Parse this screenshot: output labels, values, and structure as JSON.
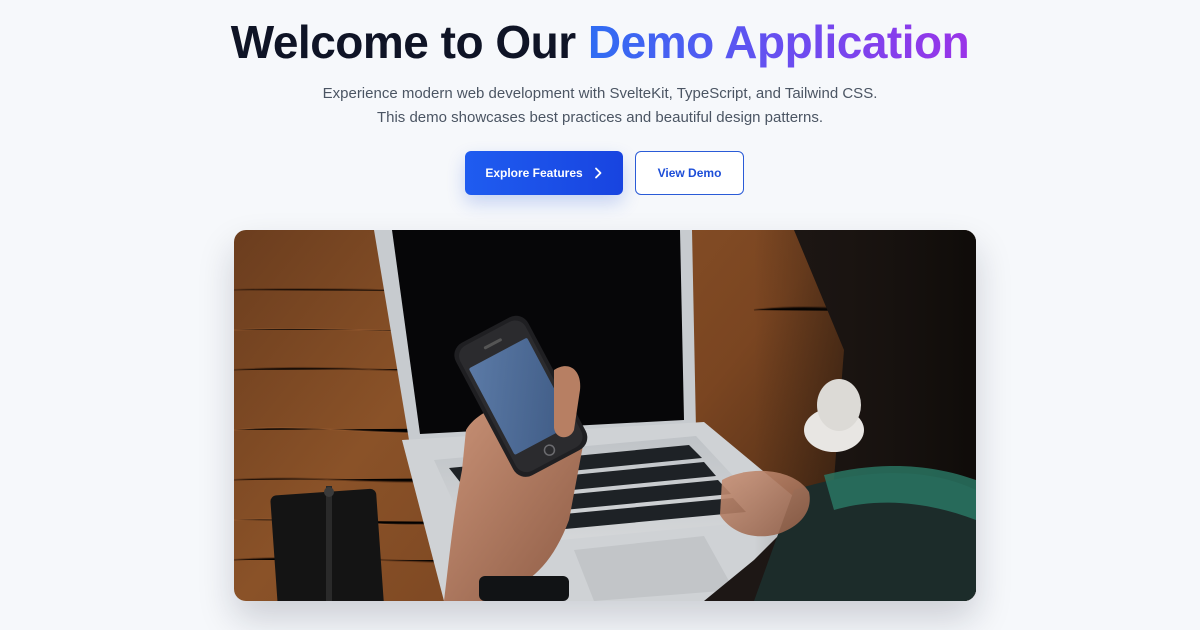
{
  "hero": {
    "title_prefix": "Welcome to Our",
    "title_accent": "Demo Application",
    "subtitle_line1": "Experience modern web development with SvelteKit, TypeScript, and Tailwind CSS.",
    "subtitle_line2": "This demo showcases best practices and beautiful design patterns.",
    "primary_button": "Explore Features",
    "secondary_button": "View Demo",
    "accent_colors": [
      "#2f6df3",
      "#6d4cf0",
      "#9a34e8"
    ],
    "primary_color": "#1f5cf0"
  },
  "image": {
    "icon": "hero-photo-laptop-phone"
  }
}
